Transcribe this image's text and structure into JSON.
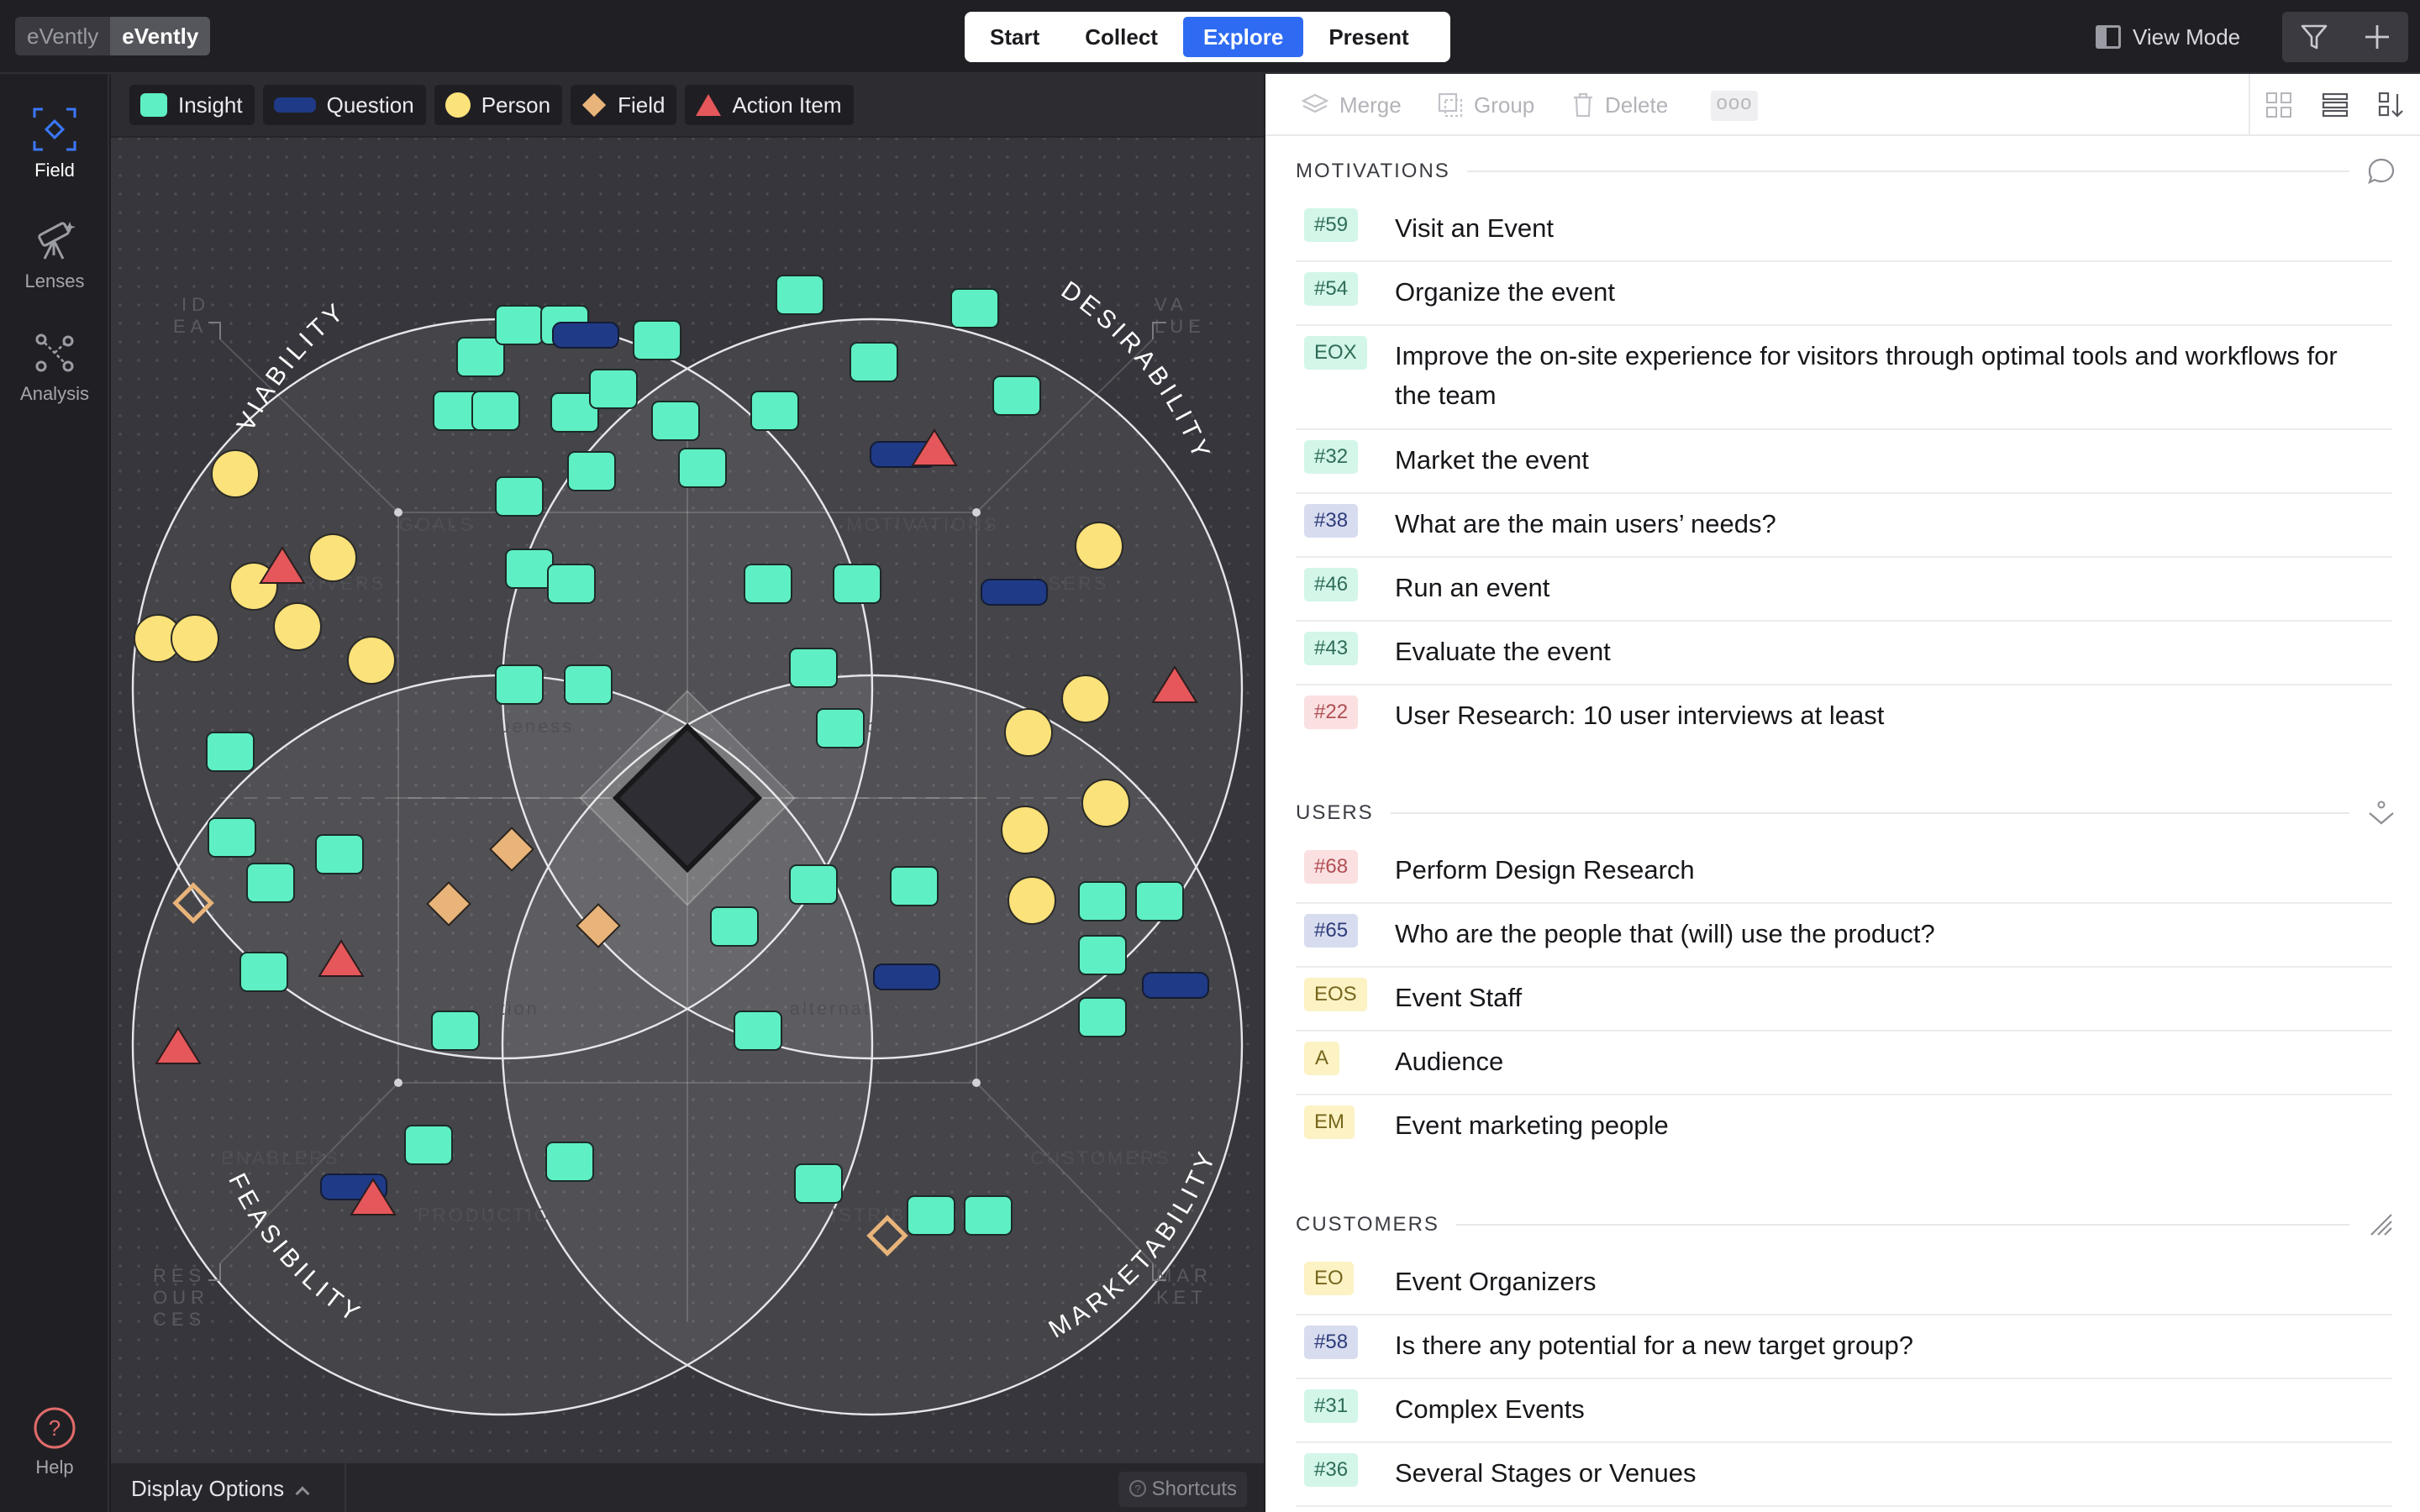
{
  "app": {
    "project_tabs": [
      "eVently",
      "eVently"
    ],
    "mode_tabs": [
      {
        "label": "Start",
        "active": false
      },
      {
        "label": "Collect",
        "active": false
      },
      {
        "label": "Explore",
        "active": true
      },
      {
        "label": "Present",
        "active": false
      }
    ],
    "view_mode_label": "View Mode",
    "top_buttons": [
      "filter-icon",
      "plus-icon"
    ],
    "accent_color": "#2f6bf2"
  },
  "sidebar": {
    "items": [
      {
        "label": "Field",
        "icon": "field-focus-icon",
        "active": true
      },
      {
        "label": "Lenses",
        "icon": "telescope-icon",
        "active": false
      },
      {
        "label": "Analysis",
        "icon": "analysis-graph-icon",
        "active": false
      }
    ],
    "help_label": "Help"
  },
  "canvas": {
    "legend": [
      {
        "label": "Insight",
        "shape": "rounded-square",
        "color": "#5ef0c4"
      },
      {
        "label": "Question",
        "shape": "pill",
        "color": "#1f3a86"
      },
      {
        "label": "Person",
        "shape": "circle",
        "color": "#fbe27a"
      },
      {
        "label": "Field",
        "shape": "diamond",
        "color": "#e9b47a"
      },
      {
        "label": "Action Item",
        "shape": "triangle",
        "color": "#e5575a"
      }
    ],
    "circle_labels": [
      "VIABILITY",
      "DESIRABILITY",
      "FEASIBILITY",
      "MARKETABILITY"
    ],
    "corner_labels": {
      "top_left": [
        "ID",
        "EA"
      ],
      "top_right": [
        "VA",
        "LUE"
      ],
      "bottom_left": [
        "RES",
        "OUR",
        "CES"
      ],
      "bottom_right": [
        "MAR",
        "KET"
      ]
    },
    "zone_labels": [
      "GOALS",
      "DRIVERS",
      "MOTIVATIONS",
      "USERS",
      "uniqueness",
      "problem",
      "solution",
      "alternatives",
      "ENABLERS",
      "CUSTOMERS",
      "PRODUCTION",
      "DISTRIBUTION"
    ],
    "display_options_label": "Display Options",
    "shortcuts_label": "Shortcuts"
  },
  "toolbar": {
    "merge_label": "Merge",
    "group_label": "Group",
    "delete_label": "Delete",
    "more_label": "ooo"
  },
  "sections": [
    {
      "title": "MOTIVATIONS",
      "icon": "comment-icon",
      "items": [
        {
          "tag": "#59",
          "color": "green",
          "text": "Visit an Event"
        },
        {
          "tag": "#54",
          "color": "green",
          "text": "Organize the event"
        },
        {
          "tag": "EOX",
          "color": "green",
          "text": "Improve the on-site experience for visitors through optimal tools and workflows for the team"
        },
        {
          "tag": "#32",
          "color": "green",
          "text": "Market the event"
        },
        {
          "tag": "#38",
          "color": "blue",
          "text": "What are the main users’ needs?"
        },
        {
          "tag": "#46",
          "color": "green",
          "text": "Run an event"
        },
        {
          "tag": "#43",
          "color": "green",
          "text": "Evaluate the event"
        },
        {
          "tag": "#22",
          "color": "red",
          "text": "User Research: 10 user interviews at least"
        }
      ]
    },
    {
      "title": "USERS",
      "icon": "user-funnel-icon",
      "items": [
        {
          "tag": "#68",
          "color": "red",
          "text": "Perform Design Research"
        },
        {
          "tag": "#65",
          "color": "blue",
          "text": "Who are the people that (will) use the product?"
        },
        {
          "tag": "EOS",
          "color": "yellow",
          "text": "Event Staff"
        },
        {
          "tag": "A",
          "color": "yellow",
          "text": "Audience"
        },
        {
          "tag": "EM",
          "color": "yellow",
          "text": "Event marketing people"
        }
      ]
    },
    {
      "title": "CUSTOMERS",
      "icon": "resize-icon",
      "items": [
        {
          "tag": "EO",
          "color": "yellow",
          "text": "Event Organizers"
        },
        {
          "tag": "#58",
          "color": "blue",
          "text": "Is there any potential for a new target group?"
        },
        {
          "tag": "#31",
          "color": "green",
          "text": "Complex Events"
        },
        {
          "tag": "#36",
          "color": "green",
          "text": "Several Stages or Venues"
        }
      ]
    }
  ]
}
